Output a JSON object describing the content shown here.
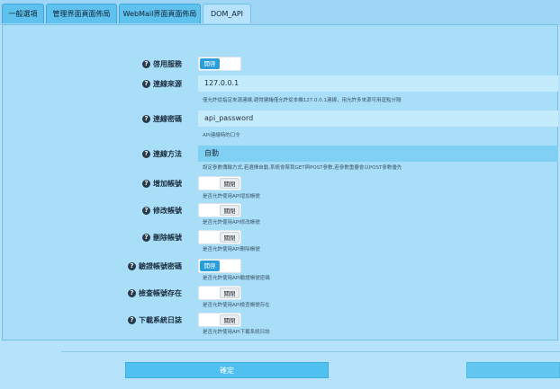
{
  "tabs": [
    {
      "label": "一般選項"
    },
    {
      "label": "管理界面頁面佈局"
    },
    {
      "label": "WebMail界面頁面佈局"
    },
    {
      "label": "DOM_API"
    }
  ],
  "form": {
    "enable_service": {
      "label": "啓用服務",
      "toggle": "開啓"
    },
    "source": {
      "label": "連線來源",
      "value": "127.0.0.1",
      "hint": "僅允許從指定來源連線,適常建議僅允許從本機127.0.0.1連線，用允許多來源可用逗點分隔"
    },
    "password": {
      "label": "連線密碼",
      "value": "api_password",
      "hint": "API連線時的口令"
    },
    "method": {
      "label": "連線方法",
      "value": "自動",
      "hint": "設定參數傳輸方式,若選擇自動,系統會幫我GET與POST參數,若參數重疊會以POST參數優先"
    },
    "add_account": {
      "label": "增加帳號",
      "toggle": "關閉",
      "hint": "是否允許使用API增加帳號"
    },
    "edit_account": {
      "label": "修改帳號",
      "toggle": "關閉",
      "hint": "是否允許使用API修改帳號"
    },
    "delete_account": {
      "label": "刪除帳號",
      "toggle": "關閉",
      "hint": "是否允許使用API刪除帳號"
    },
    "verify_password": {
      "label": "驗證帳號密碼",
      "toggle": "開啓",
      "hint": "是否允許使用API驗證帳號密碼"
    },
    "check_exists": {
      "label": "檢查帳號存在",
      "toggle": "關閉",
      "hint": "是否允許使用API檢查帳號存在"
    },
    "download_log": {
      "label": "下載系統日誌",
      "toggle": "關閉",
      "hint": "是否允許使用API下載系統日誌"
    }
  },
  "buttons": {
    "confirm": "確定"
  }
}
